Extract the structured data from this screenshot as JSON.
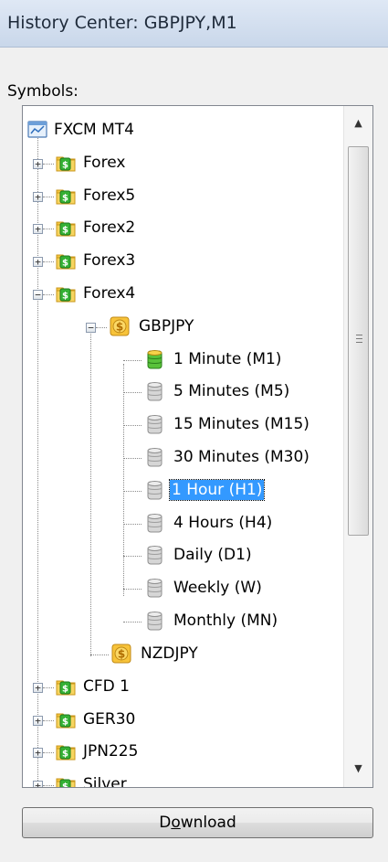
{
  "window": {
    "title": "History Center: GBPJPY,M1"
  },
  "symbols_label": "Symbols:",
  "tree": {
    "root": "FXCM MT4",
    "forex": "Forex",
    "forex5": "Forex5",
    "forex2": "Forex2",
    "forex3": "Forex3",
    "forex4": "Forex4",
    "gbpjpy": "GBPJPY",
    "m1": "1 Minute (M1)",
    "m5": "5 Minutes (M5)",
    "m15": "15 Minutes (M15)",
    "m30": "30 Minutes (M30)",
    "h1": "1 Hour (H1)",
    "h4": "4 Hours (H4)",
    "d1": "Daily (D1)",
    "w": "Weekly (W)",
    "mn": "Monthly (MN)",
    "nzdjpy": "NZDJPY",
    "cfd1": "CFD 1",
    "ger30": "GER30",
    "jpn225": "JPN225",
    "silver": "Silver",
    "selected": "1 Hour (H1)"
  },
  "buttons": {
    "download_prefix": "D",
    "download_mnemonic": "o",
    "download_suffix": "wnload"
  },
  "colors": {
    "selection": "#3399ff",
    "title_gradient": "#dfe8f5",
    "folder": "#f1c23d",
    "dollar_green": "#2fa82f",
    "dollar_gold": "#f3b329"
  },
  "icons": {
    "root": "server-chart-icon",
    "group": "folder-dollar-icon",
    "symbol": "dollar-icon",
    "period_active": "database-green-icon",
    "period": "database-gray-icon"
  }
}
